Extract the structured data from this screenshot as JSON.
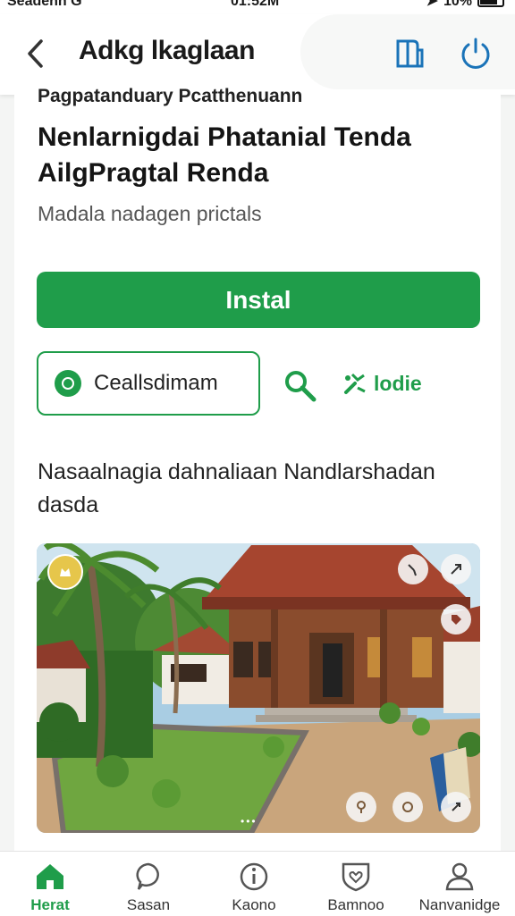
{
  "status_bar": {
    "carrier": "Seadenn G",
    "time": "01:52M",
    "battery": "10%"
  },
  "header": {
    "title": "Adkg lkaglaan",
    "back_icon": "chevron-left-icon",
    "book_icon": "book-icon",
    "power_icon": "power-icon"
  },
  "app": {
    "subheading": "Pagpatanduary Pcatthenuann",
    "name": "Nenlarnigdai Phatanial Tenda AilgPragtal Renda",
    "developer": "Madala nadagen prictals",
    "install_label": "Instal",
    "chip_label": "Ceallsdimam",
    "tools_label": "lodie",
    "description": "Nasaalnagia dahnaliaan Nandlarshadan dasda"
  },
  "screenshot": {
    "caption": "•••"
  },
  "colors": {
    "accent": "#1f9d4a",
    "background": "#f4f5f4"
  },
  "nav": [
    {
      "label": "Herat",
      "icon": "home-icon"
    },
    {
      "label": "Sasan",
      "icon": "chat-icon"
    },
    {
      "label": "Kaono",
      "icon": "info-icon"
    },
    {
      "label": "Bamnoo",
      "icon": "heart-shield-icon"
    },
    {
      "label": "Nanvanidge",
      "icon": "user-icon"
    }
  ]
}
